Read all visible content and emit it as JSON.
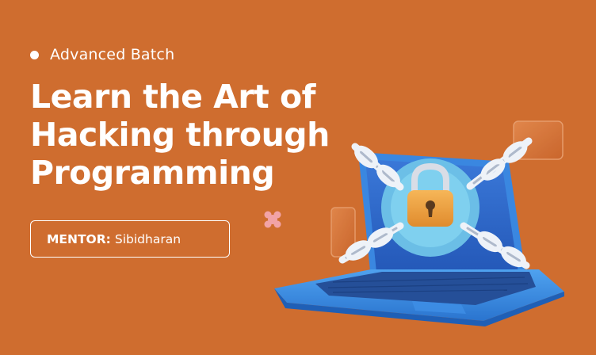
{
  "badge": {
    "text": "Advanced Batch"
  },
  "title": {
    "lines": [
      "Learn the Art of",
      "Hacking through",
      "Programming"
    ]
  },
  "mentor": {
    "label": "MENTOR:",
    "name": "Sibidharan"
  },
  "colors": {
    "background": "#cf6d2f",
    "text": "#ffffff",
    "laptop": "#3e8fe3",
    "lock_body": "#f0a646",
    "chain": "#e6ecf5"
  },
  "illustration": {
    "icon": "laptop-padlock-chain-icon"
  }
}
